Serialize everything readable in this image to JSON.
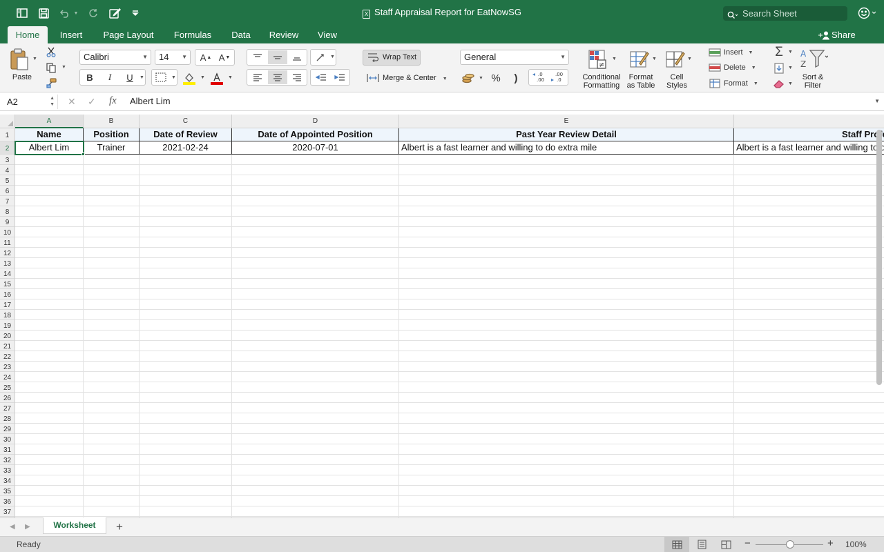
{
  "window": {
    "title": "Staff Appraisal Report for EatNowSG",
    "doc_icon": "X",
    "search_placeholder": "Search Sheet"
  },
  "ribbon_tabs": [
    {
      "label": "Home",
      "active": true
    },
    {
      "label": "Insert"
    },
    {
      "label": "Page Layout"
    },
    {
      "label": "Formulas"
    },
    {
      "label": "Data"
    },
    {
      "label": "Review"
    },
    {
      "label": "View"
    }
  ],
  "share_label": "Share",
  "ribbon": {
    "paste_label": "Paste",
    "font_name": "Calibri",
    "font_size": "14",
    "bold": "B",
    "italic": "I",
    "underline": "U",
    "grow_font": "A",
    "shrink_font": "A",
    "font_color_letter": "A",
    "wrap_text": "Wrap Text",
    "merge_center": "Merge & Center",
    "number_format": "General",
    "percent": "%",
    "comma": ")",
    "conditional_formatting": [
      "Conditional",
      "Formatting"
    ],
    "format_as_table": [
      "Format",
      "as Table"
    ],
    "cell_styles": [
      "Cell",
      "Styles"
    ],
    "insert": "Insert",
    "delete": "Delete",
    "format": "Format",
    "sort_filter": [
      "Sort &",
      "Filter"
    ],
    "fill_color": "#ffee00",
    "font_color": "#e00000"
  },
  "formula_bar": {
    "name_box": "A2",
    "fx": "fx",
    "value": "Albert Lim"
  },
  "columns": [
    "A",
    "B",
    "C",
    "D",
    "E"
  ],
  "selected_column": "A",
  "rows": [
    "1",
    "2",
    "3",
    "4",
    "5",
    "6",
    "7",
    "8",
    "9",
    "10",
    "11",
    "12",
    "13",
    "14",
    "15",
    "16",
    "17",
    "18",
    "19",
    "20",
    "21",
    "22",
    "23",
    "24",
    "25",
    "26",
    "27",
    "28",
    "29",
    "30",
    "31",
    "32",
    "33",
    "34",
    "35",
    "36",
    "37"
  ],
  "selected_row": "2",
  "table": {
    "headers": [
      "Name",
      "Position",
      "Date of Review",
      "Date of Appointed Position",
      "Past Year Review Detail",
      "Staff Profe"
    ],
    "row1": [
      "Albert Lim",
      "Trainer",
      "2021-02-24",
      "2020-07-01",
      "Albert is a fast learner and willing to do extra mile",
      "Albert is a fast learner and willing to do"
    ]
  },
  "sheet_tabs": [
    {
      "label": "Worksheet",
      "active": true
    }
  ],
  "add_sheet": "+",
  "status": {
    "text": "Ready",
    "zoom": "100%",
    "zoom_minus": "−",
    "zoom_plus": "+"
  },
  "colors": {
    "brand": "#217346",
    "header_fill": "#eef5fc"
  }
}
